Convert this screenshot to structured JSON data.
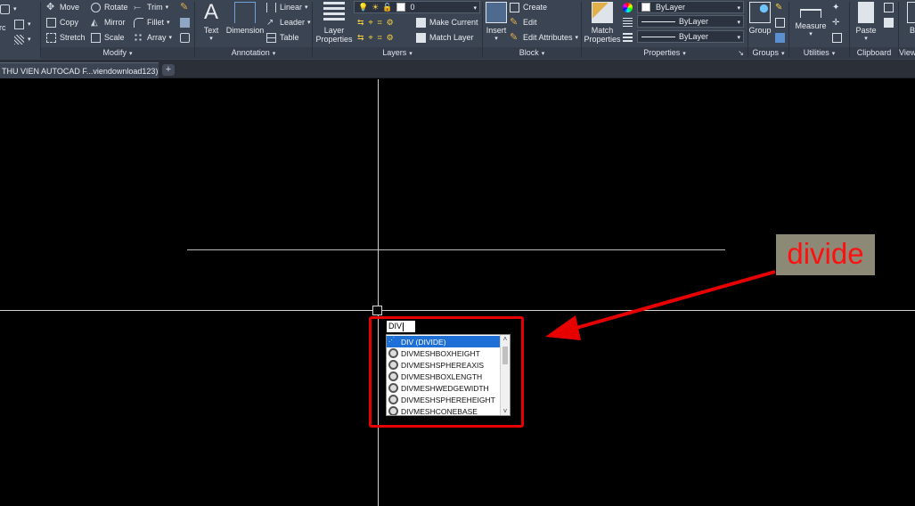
{
  "ribbon": {
    "draw_partial": "arc",
    "modify": {
      "title": "Modify",
      "items": [
        "Move",
        "Rotate",
        "Trim",
        "Copy",
        "Mirror",
        "Fillet",
        "Stretch",
        "Scale",
        "Array"
      ]
    },
    "annotation": {
      "title": "Annotation",
      "text": "Text",
      "dimension": "Dimension",
      "linear": "Linear",
      "leader": "Leader",
      "table": "Table"
    },
    "layers": {
      "title": "Layers",
      "layer_properties": "Layer Properties",
      "current_layer": "0",
      "make_current": "Make Current",
      "match_layer": "Match Layer"
    },
    "block": {
      "title": "Block",
      "insert": "Insert",
      "create": "Create",
      "edit": "Edit",
      "edit_attributes": "Edit Attributes"
    },
    "properties": {
      "title": "Properties",
      "match_properties": "Match Properties",
      "color": "ByLayer",
      "linetype": "ByLayer",
      "lineweight": "ByLayer"
    },
    "groups": {
      "title": "Groups",
      "group": "Group"
    },
    "utilities": {
      "title": "Utilities",
      "measure": "Measure"
    },
    "clipboard": {
      "title": "Clipboard",
      "paste": "Paste"
    },
    "view_partial": "View",
    "bi_partial": "Bi"
  },
  "tabs": {
    "document": "THU VIEN AUTOCAD F...viendownload123)*",
    "new_tab": "+"
  },
  "command": {
    "typed": "DIV",
    "suggestions": [
      "DIV (DIVIDE)",
      "DIVMESHBOXHEIGHT",
      "DIVMESHSPHEREAXIS",
      "DIVMESHBOXLENGTH",
      "DIVMESHWEDGEWIDTH",
      "DIVMESHSPHEREHEIGHT",
      "DIVMESHCONEBASE"
    ],
    "selected_index": 0
  },
  "annotation_callout": {
    "label": "divide",
    "color": "#ff1010",
    "box_color": "#e60000"
  }
}
